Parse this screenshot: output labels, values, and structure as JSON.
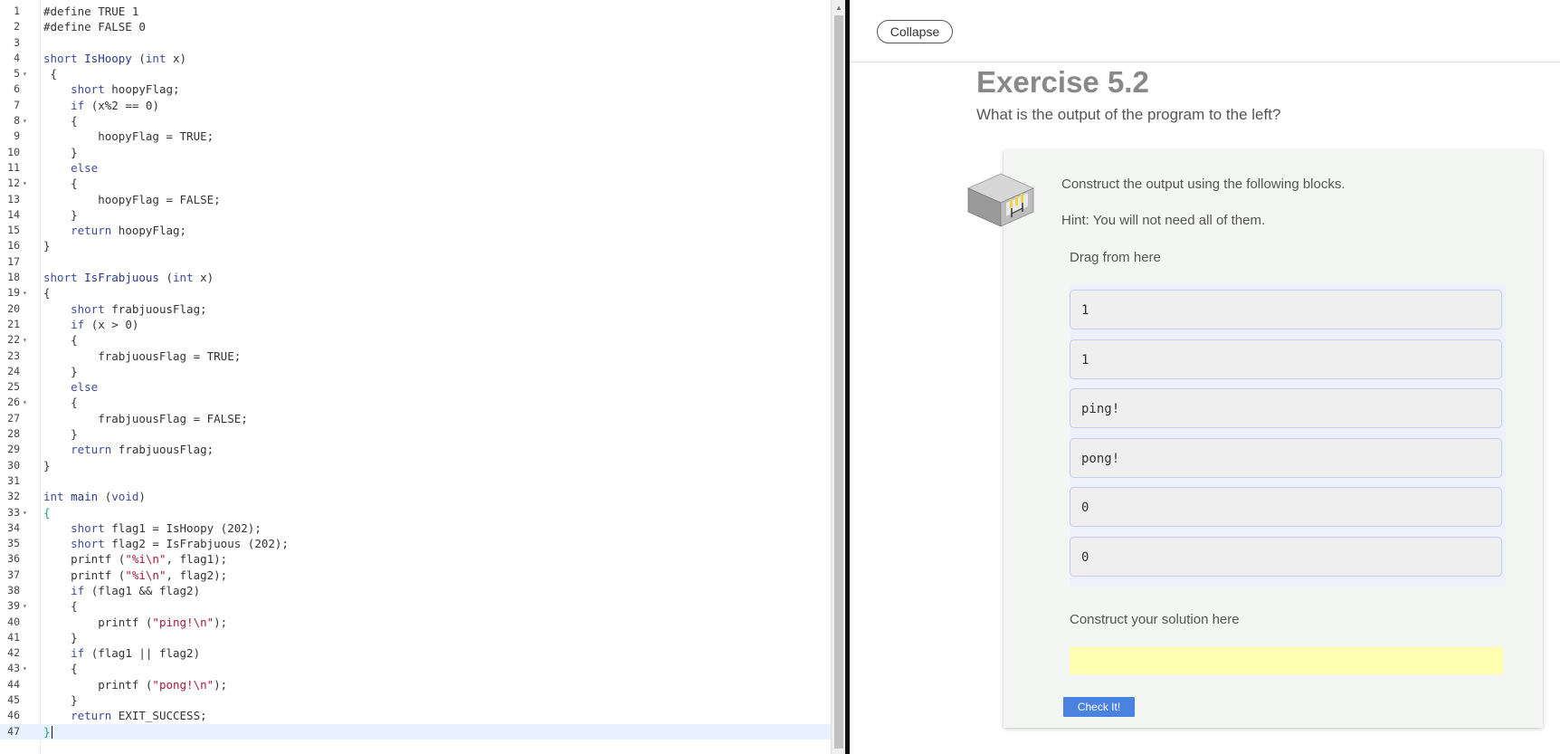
{
  "editor": {
    "lines": [
      {
        "n": "1",
        "fold": false,
        "segs": [
          {
            "t": "#define TRUE 1"
          }
        ]
      },
      {
        "n": "2",
        "fold": false,
        "segs": [
          {
            "t": "#define FALSE 0"
          }
        ]
      },
      {
        "n": "3",
        "fold": false,
        "segs": []
      },
      {
        "n": "4",
        "fold": false,
        "segs": [
          {
            "t": "short ",
            "c": "t-kw"
          },
          {
            "t": "IsHoopy",
            "c": "t-fn"
          },
          {
            "t": " ("
          },
          {
            "t": "int",
            "c": "t-kw"
          },
          {
            "t": " x)"
          }
        ]
      },
      {
        "n": "5",
        "fold": true,
        "segs": [
          {
            "t": " {"
          }
        ]
      },
      {
        "n": "6",
        "fold": false,
        "segs": [
          {
            "t": "    "
          },
          {
            "t": "short",
            "c": "t-kw"
          },
          {
            "t": " hoopyFlag;"
          }
        ]
      },
      {
        "n": "7",
        "fold": false,
        "segs": [
          {
            "t": "    "
          },
          {
            "t": "if",
            "c": "t-kw"
          },
          {
            "t": " (x%2 == "
          },
          {
            "t": "0",
            "c": "t-num"
          },
          {
            "t": ")"
          }
        ]
      },
      {
        "n": "8",
        "fold": true,
        "segs": [
          {
            "t": "    {"
          }
        ]
      },
      {
        "n": "9",
        "fold": false,
        "segs": [
          {
            "t": "        hoopyFlag = TRUE;"
          }
        ]
      },
      {
        "n": "10",
        "fold": false,
        "segs": [
          {
            "t": "    }"
          }
        ]
      },
      {
        "n": "11",
        "fold": false,
        "segs": [
          {
            "t": "    "
          },
          {
            "t": "else",
            "c": "t-kw"
          }
        ]
      },
      {
        "n": "12",
        "fold": true,
        "segs": [
          {
            "t": "    {"
          }
        ]
      },
      {
        "n": "13",
        "fold": false,
        "segs": [
          {
            "t": "        hoopyFlag = FALSE;"
          }
        ]
      },
      {
        "n": "14",
        "fold": false,
        "segs": [
          {
            "t": "    }"
          }
        ]
      },
      {
        "n": "15",
        "fold": false,
        "segs": [
          {
            "t": "    "
          },
          {
            "t": "return",
            "c": "t-kw"
          },
          {
            "t": " hoopyFlag;"
          }
        ]
      },
      {
        "n": "16",
        "fold": false,
        "segs": [
          {
            "t": "}"
          }
        ]
      },
      {
        "n": "17",
        "fold": false,
        "segs": []
      },
      {
        "n": "18",
        "fold": false,
        "segs": [
          {
            "t": "short ",
            "c": "t-kw"
          },
          {
            "t": "IsFrabjuous",
            "c": "t-fn"
          },
          {
            "t": " ("
          },
          {
            "t": "int",
            "c": "t-kw"
          },
          {
            "t": " x)"
          }
        ]
      },
      {
        "n": "19",
        "fold": true,
        "segs": [
          {
            "t": "{"
          }
        ]
      },
      {
        "n": "20",
        "fold": false,
        "segs": [
          {
            "t": "    "
          },
          {
            "t": "short",
            "c": "t-kw"
          },
          {
            "t": " frabjuousFlag;"
          }
        ]
      },
      {
        "n": "21",
        "fold": false,
        "segs": [
          {
            "t": "    "
          },
          {
            "t": "if",
            "c": "t-kw"
          },
          {
            "t": " (x > "
          },
          {
            "t": "0",
            "c": "t-num"
          },
          {
            "t": ")"
          }
        ]
      },
      {
        "n": "22",
        "fold": true,
        "segs": [
          {
            "t": "    {"
          }
        ]
      },
      {
        "n": "23",
        "fold": false,
        "segs": [
          {
            "t": "        frabjuousFlag = TRUE;"
          }
        ]
      },
      {
        "n": "24",
        "fold": false,
        "segs": [
          {
            "t": "    }"
          }
        ]
      },
      {
        "n": "25",
        "fold": false,
        "segs": [
          {
            "t": "    "
          },
          {
            "t": "else",
            "c": "t-kw"
          }
        ]
      },
      {
        "n": "26",
        "fold": true,
        "segs": [
          {
            "t": "    {"
          }
        ]
      },
      {
        "n": "27",
        "fold": false,
        "segs": [
          {
            "t": "        frabjuousFlag = FALSE;"
          }
        ]
      },
      {
        "n": "28",
        "fold": false,
        "segs": [
          {
            "t": "    }"
          }
        ]
      },
      {
        "n": "29",
        "fold": false,
        "segs": [
          {
            "t": "    "
          },
          {
            "t": "return",
            "c": "t-kw"
          },
          {
            "t": " frabjuousFlag;"
          }
        ]
      },
      {
        "n": "30",
        "fold": false,
        "segs": [
          {
            "t": "}"
          }
        ]
      },
      {
        "n": "31",
        "fold": false,
        "segs": []
      },
      {
        "n": "32",
        "fold": false,
        "segs": [
          {
            "t": "int",
            "c": "t-kw"
          },
          {
            "t": " "
          },
          {
            "t": "main",
            "c": "t-fn"
          },
          {
            "t": " ("
          },
          {
            "t": "void",
            "c": "t-kw"
          },
          {
            "t": ")"
          }
        ]
      },
      {
        "n": "33",
        "fold": true,
        "segs": [
          {
            "t": "{",
            "c": "t-brace-hl"
          }
        ]
      },
      {
        "n": "34",
        "fold": false,
        "segs": [
          {
            "t": "    "
          },
          {
            "t": "short",
            "c": "t-kw"
          },
          {
            "t": " flag1 = IsHoopy ("
          },
          {
            "t": "202",
            "c": "t-num"
          },
          {
            "t": ");"
          }
        ]
      },
      {
        "n": "35",
        "fold": false,
        "segs": [
          {
            "t": "    "
          },
          {
            "t": "short",
            "c": "t-kw"
          },
          {
            "t": " flag2 = IsFrabjuous ("
          },
          {
            "t": "202",
            "c": "t-num"
          },
          {
            "t": ");"
          }
        ]
      },
      {
        "n": "36",
        "fold": false,
        "segs": [
          {
            "t": "    printf ("
          },
          {
            "t": "\"%i\\n\"",
            "c": "t-str"
          },
          {
            "t": ", flag1);"
          }
        ]
      },
      {
        "n": "37",
        "fold": false,
        "segs": [
          {
            "t": "    printf ("
          },
          {
            "t": "\"%i\\n\"",
            "c": "t-str"
          },
          {
            "t": ", flag2);"
          }
        ]
      },
      {
        "n": "38",
        "fold": false,
        "segs": [
          {
            "t": "    "
          },
          {
            "t": "if",
            "c": "t-kw"
          },
          {
            "t": " (flag1 && flag2)"
          }
        ]
      },
      {
        "n": "39",
        "fold": true,
        "segs": [
          {
            "t": "    {"
          }
        ]
      },
      {
        "n": "40",
        "fold": false,
        "segs": [
          {
            "t": "        printf ("
          },
          {
            "t": "\"ping!\\n\"",
            "c": "t-str"
          },
          {
            "t": ");"
          }
        ]
      },
      {
        "n": "41",
        "fold": false,
        "segs": [
          {
            "t": "    }"
          }
        ]
      },
      {
        "n": "42",
        "fold": false,
        "segs": [
          {
            "t": "    "
          },
          {
            "t": "if",
            "c": "t-kw"
          },
          {
            "t": " (flag1 || flag2)"
          }
        ]
      },
      {
        "n": "43",
        "fold": true,
        "segs": [
          {
            "t": "    {"
          }
        ]
      },
      {
        "n": "44",
        "fold": false,
        "segs": [
          {
            "t": "        printf ("
          },
          {
            "t": "\"pong!\\n\"",
            "c": "t-str"
          },
          {
            "t": ");"
          }
        ]
      },
      {
        "n": "45",
        "fold": false,
        "segs": [
          {
            "t": "    }"
          }
        ]
      },
      {
        "n": "46",
        "fold": false,
        "segs": [
          {
            "t": "    "
          },
          {
            "t": "return",
            "c": "t-kw"
          },
          {
            "t": " EXIT_SUCCESS;"
          }
        ]
      },
      {
        "n": "47",
        "fold": false,
        "active": true,
        "caret": true,
        "segs": [
          {
            "t": "}",
            "c": "t-brace-hl"
          }
        ]
      }
    ]
  },
  "exercise": {
    "collapse_label": "Collapse",
    "title": "Exercise 5.2",
    "question": "What is the output of the program to the left?",
    "instruction": "Construct the output using the following blocks.",
    "hint": "Hint: You will not need all of them.",
    "drag_label": "Drag from here",
    "blocks": [
      "1",
      "1",
      "ping!",
      "pong!",
      "0",
      "0"
    ],
    "solution_label": "Construct your solution here",
    "check_label": "Check It!"
  }
}
